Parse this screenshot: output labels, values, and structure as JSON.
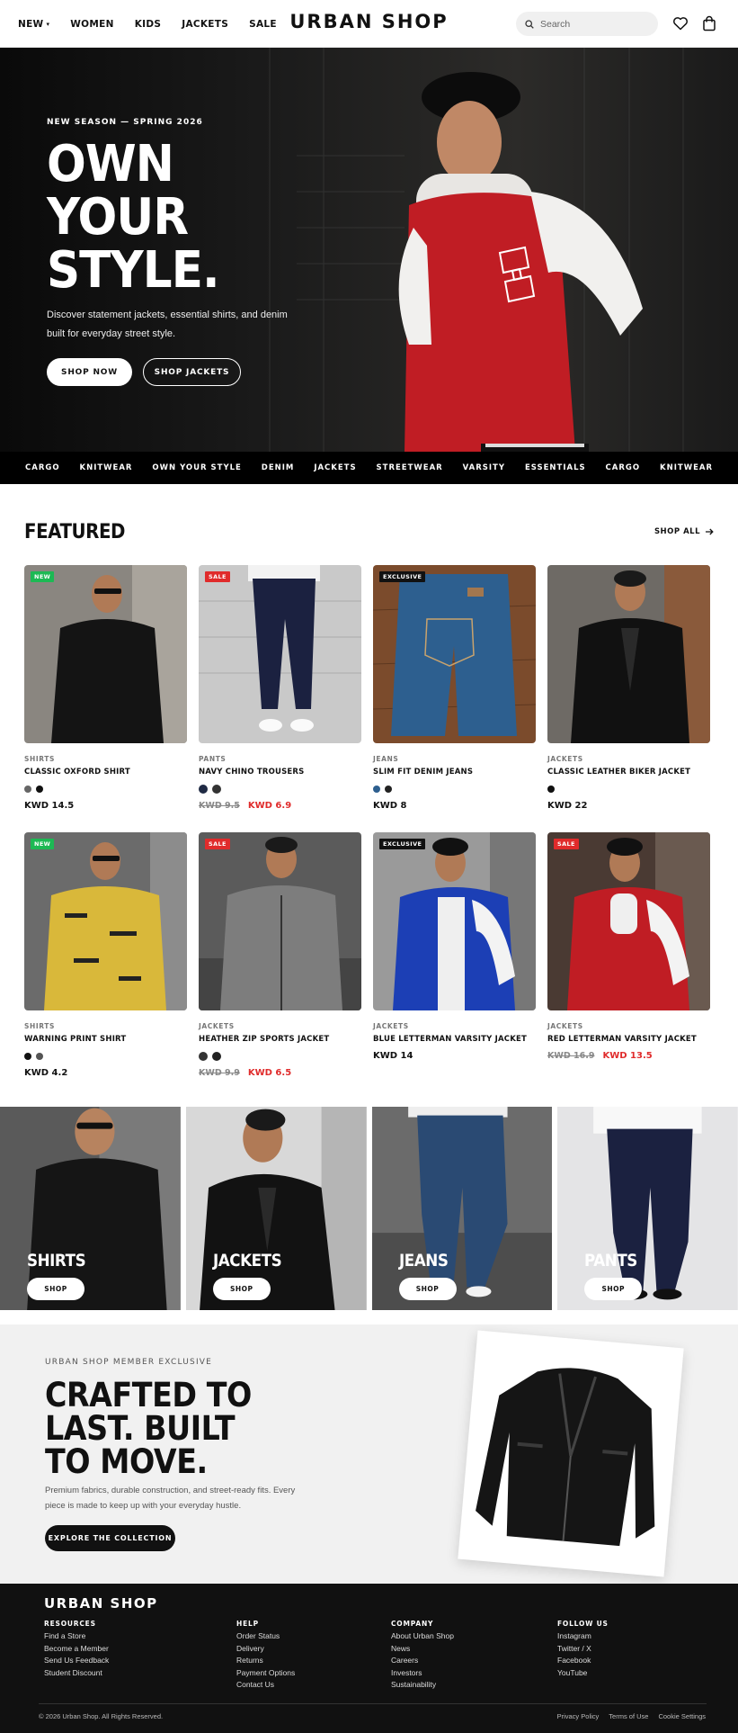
{
  "header": {
    "logo": "URBAN SHOP",
    "nav": [
      "NEW",
      "WOMEN",
      "KIDS",
      "JACKETS",
      "SALE"
    ],
    "search_placeholder": "Search"
  },
  "hero": {
    "eyebrow": "NEW SEASON — SPRING 2026",
    "title_lines": [
      "OWN",
      "YOUR",
      "STYLE."
    ],
    "description": "Discover statement jackets, essential shirts, and denim built for everyday street style.",
    "primary_cta": "SHOP NOW",
    "secondary_cta": "SHOP JACKETS"
  },
  "marquee": [
    "CARGO",
    "KNITWEAR",
    "OWN YOUR STYLE",
    "DENIM",
    "JACKETS",
    "STREETWEAR",
    "VARSITY",
    "ESSENTIALS",
    "CARGO",
    "KNITWEAR"
  ],
  "featured": {
    "title": "FEATURED",
    "shop_all": "SHOP ALL",
    "products": [
      {
        "badge": "NEW",
        "badge_color": "#1db954",
        "category": "SHIRTS",
        "name": "CLASSIC OXFORD SHIRT",
        "swatches": [
          "#666666",
          "#111111"
        ],
        "price": "KWD 14.5",
        "old_price": ""
      },
      {
        "badge": "SALE",
        "badge_color": "#e02b2b",
        "category": "PANTS",
        "name": "NAVY CHINO TROUSERS",
        "swatches": [
          "#1f2a44",
          "#333333"
        ],
        "price": "KWD 6.9",
        "old_price": "KWD 9.5"
      },
      {
        "badge": "EXCLUSIVE",
        "badge_color": "#111111",
        "category": "JEANS",
        "name": "SLIM FIT DENIM JEANS",
        "swatches": [
          "#2d5f8f",
          "#222222"
        ],
        "price": "KWD 8",
        "old_price": ""
      },
      {
        "badge": "",
        "badge_color": "",
        "category": "JACKETS",
        "name": "CLASSIC LEATHER BIKER JACKET",
        "swatches": [
          "#111111"
        ],
        "price": "KWD 22",
        "old_price": ""
      },
      {
        "badge": "NEW",
        "badge_color": "#1db954",
        "category": "SHIRTS",
        "name": "WARNING PRINT SHIRT",
        "swatches": [
          "#111111",
          "#555555"
        ],
        "price": "KWD 4.2",
        "old_price": ""
      },
      {
        "badge": "SALE",
        "badge_color": "#e02b2b",
        "category": "JACKETS",
        "name": "HEATHER ZIP SPORTS JACKET",
        "swatches": [
          "#333333",
          "#222222"
        ],
        "price": "KWD 6.5",
        "old_price": "KWD 9.9"
      },
      {
        "badge": "EXCLUSIVE",
        "badge_color": "#111111",
        "category": "JACKETS",
        "name": "BLUE LETTERMAN VARSITY JACKET",
        "swatches": [],
        "price": "KWD 14",
        "old_price": ""
      },
      {
        "badge": "SALE",
        "badge_color": "#e02b2b",
        "category": "JACKETS",
        "name": "RED LETTERMAN VARSITY JACKET",
        "swatches": [],
        "price": "KWD 13.5",
        "old_price": "KWD 16.9"
      }
    ]
  },
  "categories": [
    {
      "label": "SHIRTS",
      "cta": "SHOP"
    },
    {
      "label": "JACKETS",
      "cta": "SHOP"
    },
    {
      "label": "JEANS",
      "cta": "SHOP"
    },
    {
      "label": "PANTS",
      "cta": "SHOP"
    }
  ],
  "promo": {
    "eyebrow": "URBAN SHOP MEMBER EXCLUSIVE",
    "title_lines": [
      "CRAFTED TO",
      "LAST. BUILT",
      "TO MOVE."
    ],
    "description": "Premium fabrics, durable construction, and street-ready fits. Every piece is made to keep up with your everyday hustle.",
    "cta": "EXPLORE THE COLLECTION"
  },
  "footer": {
    "logo": "URBAN SHOP",
    "columns": [
      {
        "title": "RESOURCES",
        "links": [
          "Find a Store",
          "Become a Member",
          "Send Us Feedback",
          "Student Discount"
        ]
      },
      {
        "title": "HELP",
        "links": [
          "Order Status",
          "Delivery",
          "Returns",
          "Payment Options",
          "Contact Us"
        ]
      },
      {
        "title": "COMPANY",
        "links": [
          "About Urban Shop",
          "News",
          "Careers",
          "Investors",
          "Sustainability"
        ]
      },
      {
        "title": "FOLLOW US",
        "links": [
          "Instagram",
          "Twitter / X",
          "Facebook",
          "YouTube"
        ]
      }
    ],
    "copyright": "© 2026 Urban Shop. All Rights Reserved.",
    "legal": [
      "Privacy Policy",
      "Terms of Use",
      "Cookie Settings"
    ]
  }
}
